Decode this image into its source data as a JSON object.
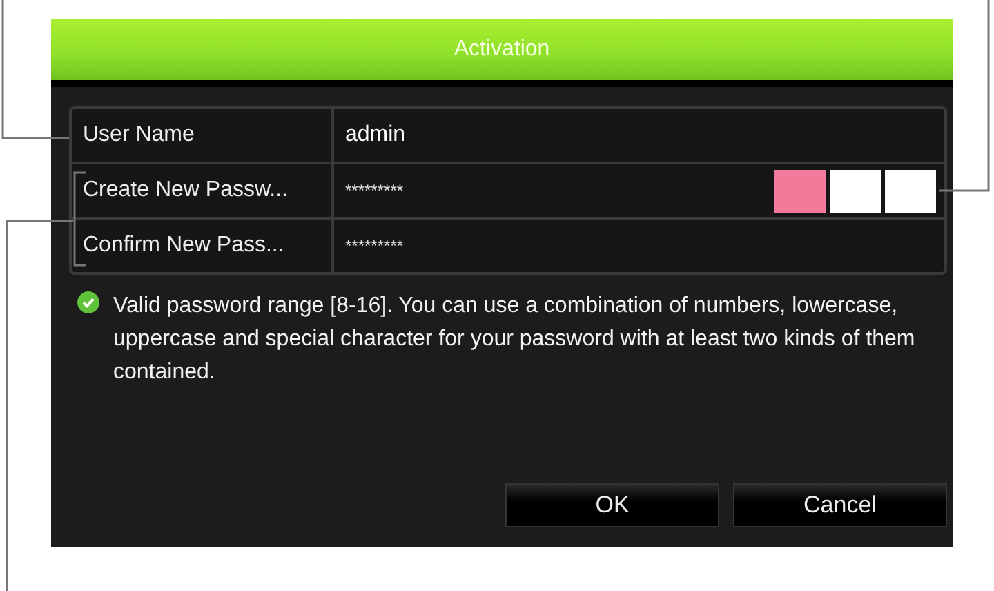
{
  "dialog": {
    "title": "Activation"
  },
  "fields": [
    {
      "label": "User Name",
      "value": "admin",
      "kind": "text"
    },
    {
      "label": "Create New Passw...",
      "value": "*********",
      "kind": "password",
      "strength": {
        "level": 0.333
      }
    },
    {
      "label": "Confirm New Pass...",
      "value": "*********",
      "kind": "password"
    }
  ],
  "hint": {
    "valid": true,
    "text": "Valid password range [8-16]. You can use a combination of numbers, lowercase, uppercase and special character for your password with at least two kinds of them contained."
  },
  "buttons": [
    "OK",
    "Cancel"
  ]
}
